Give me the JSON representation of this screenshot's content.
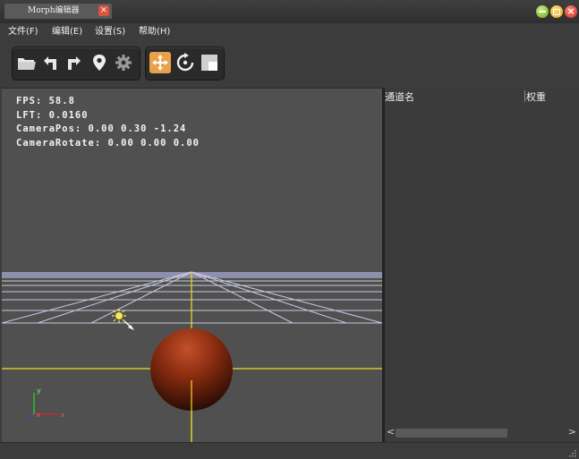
{
  "window": {
    "tab_title": "Morph编辑器",
    "tab_close": "×",
    "close_glyph": "×"
  },
  "menu": {
    "file": "文件(F)",
    "edit": "编辑(E)",
    "settings": "设置(S)",
    "help": "帮助(H)"
  },
  "toolbar": {
    "group1": [
      "folder-icon",
      "undo-icon",
      "redo-icon",
      "location-pin-icon",
      "gear-icon"
    ],
    "group2": [
      "move-icon",
      "rotate-icon",
      "scale-icon"
    ],
    "active_color": "#e9a24b"
  },
  "viewport": {
    "stats": {
      "fps": "FPS: 58.8",
      "lft": "LFT: 0.0160",
      "camera_pos": "CameraPos: 0.00 0.30 -1.24",
      "camera_rotate": "CameraRotate: 0.00 0.00 0.00"
    },
    "axis_label_y": "y",
    "grid_color": "#c9c9e0",
    "axis_color": "#e8e020",
    "sphere_color": "#8a2c10"
  },
  "channel_panel": {
    "columns": [
      "通道名",
      "权重"
    ],
    "rows": [],
    "scroll_left": "<",
    "scroll_right": ">"
  }
}
